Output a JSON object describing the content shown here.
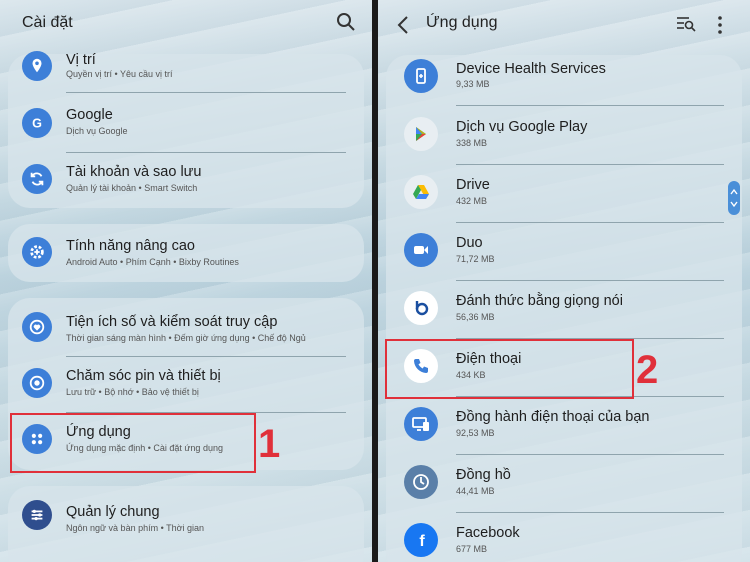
{
  "left": {
    "title": "Cài đặt",
    "items": [
      {
        "title": "Vị trí",
        "subtitle": "Quyền vị trí  •  Yêu cầu vị trí"
      },
      {
        "title": "Google",
        "subtitle": "Dịch vụ Google"
      },
      {
        "title": "Tài khoản và sao lưu",
        "subtitle": "Quản lý tài khoản  •  Smart Switch"
      },
      {
        "title": "Tính năng nâng cao",
        "subtitle": "Android Auto  •  Phím Cạnh  •  Bixby Routines"
      },
      {
        "title": "Tiện ích số và kiểm soát truy cập",
        "subtitle": "Thời gian sáng màn hình  •  Đếm giờ ứng dụng  •  Chế độ Ngủ"
      },
      {
        "title": "Chăm sóc pin và thiết bị",
        "subtitle": "Lưu trữ  •  Bộ nhớ  •  Bảo vệ thiết bị"
      },
      {
        "title": "Ứng dụng",
        "subtitle": "Ứng dụng mặc định  •  Cài đặt ứng dụng"
      },
      {
        "title": "Quản lý chung",
        "subtitle": "Ngôn ngữ và bàn phím  •  Thời gian"
      }
    ],
    "step_label": "1"
  },
  "right": {
    "title": "Ứng dụng",
    "apps": [
      {
        "name": "Device Health Services",
        "size": "9,33 MB"
      },
      {
        "name": "Dịch vụ Google Play",
        "size": "338 MB"
      },
      {
        "name": "Drive",
        "size": "432 MB"
      },
      {
        "name": "Duo",
        "size": "71,72 MB"
      },
      {
        "name": "Đánh thức bằng giọng nói",
        "size": "56,36 MB"
      },
      {
        "name": "Điện thoại",
        "size": "434 KB"
      },
      {
        "name": "Đồng hành điện thoại của bạn",
        "size": "92,53 MB"
      },
      {
        "name": "Đồng hồ",
        "size": "44,41 MB"
      },
      {
        "name": "Facebook",
        "size": "677 MB"
      }
    ],
    "step_label": "2"
  },
  "colors": {
    "accent_blue": "#3d7fd8",
    "highlight_red": "#e0303a"
  }
}
